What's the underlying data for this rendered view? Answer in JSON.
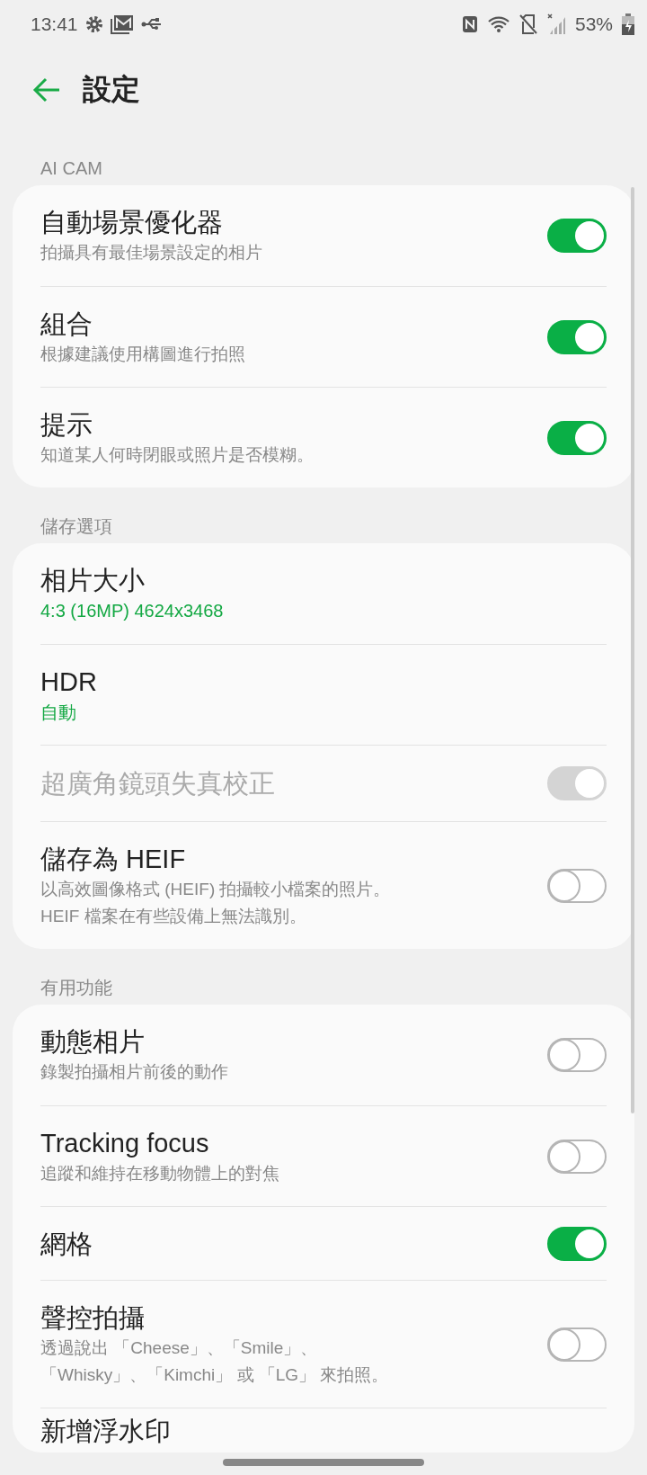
{
  "status_bar": {
    "time": "13:41",
    "battery": "53%"
  },
  "header": {
    "title": "設定"
  },
  "sections": [
    {
      "header": "AI CAM",
      "items": [
        {
          "kind": "toggle",
          "title": "自動場景優化器",
          "subtitle": "拍攝具有最佳場景設定的相片",
          "on": true,
          "disabled": false
        },
        {
          "kind": "toggle",
          "title": "組合",
          "subtitle": "根據建議使用構圖進行拍照",
          "on": true,
          "disabled": false
        },
        {
          "kind": "toggle",
          "title": "提示",
          "subtitle": "知道某人何時閉眼或照片是否模糊。",
          "on": true,
          "disabled": false
        }
      ]
    },
    {
      "header": "儲存選項",
      "items": [
        {
          "kind": "value",
          "title": "相片大小",
          "value": "4:3 (16MP) 4624x3468"
        },
        {
          "kind": "value",
          "title": "HDR",
          "value": "自動"
        },
        {
          "kind": "toggle",
          "title": "超廣角鏡頭失真校正",
          "on": true,
          "disabled": true
        },
        {
          "kind": "toggle",
          "title": "儲存為 HEIF",
          "subtitle": "以高效圖像格式 (HEIF) 拍攝較小檔案的照片。\nHEIF 檔案在有些設備上無法識別。",
          "on": false,
          "disabled": false
        }
      ]
    },
    {
      "header": "有用功能",
      "items": [
        {
          "kind": "toggle",
          "title": "動態相片",
          "subtitle": "錄製拍攝相片前後的動作",
          "on": false,
          "disabled": false
        },
        {
          "kind": "toggle",
          "title": "Tracking focus",
          "subtitle": "追蹤和維持在移動物體上的對焦",
          "on": false,
          "disabled": false
        },
        {
          "kind": "toggle",
          "title": "網格",
          "on": true,
          "disabled": false
        },
        {
          "kind": "toggle",
          "title": "聲控拍攝",
          "subtitle": [
            "透過說出 「Cheese」、「Smile」、",
            "「Whisky」、「Kimchi」 或 「LG」 來拍照。"
          ],
          "on": false,
          "disabled": false
        },
        {
          "kind": "plain",
          "title": "新增浮水印"
        }
      ]
    }
  ]
}
